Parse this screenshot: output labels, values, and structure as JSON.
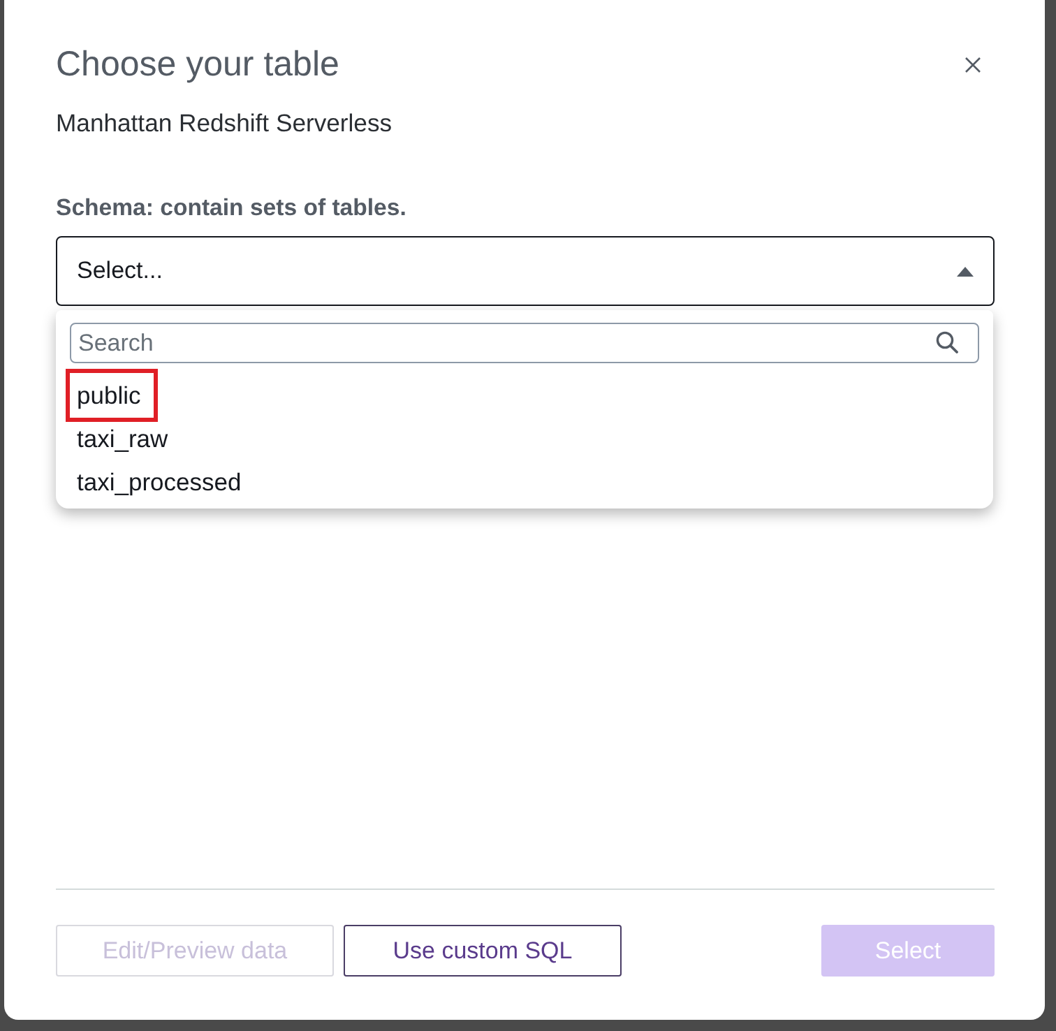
{
  "dialog": {
    "title": "Choose your table",
    "subtitle": "Manhattan Redshift Serverless"
  },
  "schema_field": {
    "label": "Schema: contain sets of tables.",
    "placeholder": "Select...",
    "expanded": true
  },
  "dropdown": {
    "search": {
      "placeholder": "Search"
    },
    "options": [
      {
        "label": "public",
        "selected": false,
        "highlighted": true
      },
      {
        "label": "taxi_raw",
        "selected": false,
        "highlighted": false
      },
      {
        "label": "taxi_processed",
        "selected": false,
        "highlighted": false
      }
    ]
  },
  "buttons": [
    {
      "label": "Edit/Preview data",
      "kind": "normal",
      "disabled": true
    },
    {
      "label": "Use custom SQL",
      "kind": "normal",
      "disabled": false
    },
    {
      "label": "Select",
      "kind": "primary",
      "disabled": true
    }
  ]
}
